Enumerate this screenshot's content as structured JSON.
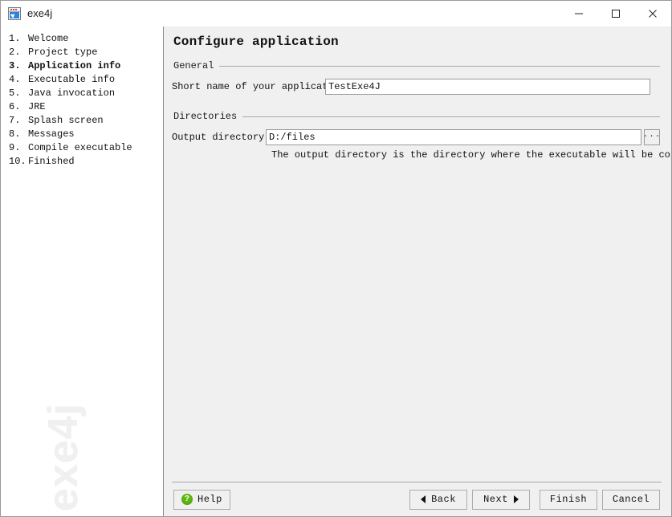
{
  "window": {
    "title": "exe4j",
    "icon": "exe4j-app-icon",
    "controls": {
      "minimize": "minimize-icon",
      "maximize": "maximize-icon",
      "close": "close-icon"
    }
  },
  "sidebar": {
    "watermark": "exe4j",
    "items": [
      {
        "num": "1.",
        "label": "Welcome",
        "active": false
      },
      {
        "num": "2.",
        "label": "Project type",
        "active": false
      },
      {
        "num": "3.",
        "label": "Application info",
        "active": true
      },
      {
        "num": "4.",
        "label": "Executable info",
        "active": false
      },
      {
        "num": "5.",
        "label": "Java invocation",
        "active": false
      },
      {
        "num": "6.",
        "label": "JRE",
        "active": false
      },
      {
        "num": "7.",
        "label": "Splash screen",
        "active": false
      },
      {
        "num": "8.",
        "label": "Messages",
        "active": false
      },
      {
        "num": "9.",
        "label": "Compile executable",
        "active": false
      },
      {
        "num": "10.",
        "label": "Finished",
        "active": false
      }
    ]
  },
  "main": {
    "page_title": "Configure application",
    "groups": {
      "general": {
        "label": "General",
        "short_name": {
          "label": "Short name of your application:",
          "value": "TestExe4J",
          "placeholder": ""
        }
      },
      "directories": {
        "label": "Directories",
        "output_directory": {
          "label": "Output directory:",
          "value": "D:/files",
          "placeholder": "",
          "browse_label": "...",
          "hint": "The output directory is the directory where the executable will be copied."
        }
      }
    }
  },
  "footer": {
    "help_label": "Help",
    "back_label": "Back",
    "next_label": "Next",
    "finish_label": "Finish",
    "cancel_label": "Cancel"
  },
  "colors": {
    "panel_bg": "#f0f0f0",
    "window_bg": "#ffffff",
    "border": "#9a9a9a",
    "help_green": "#5cb811",
    "accent_purple": "#5a3b8c",
    "icon_blue": "#2f82d8",
    "watermark": "#f0f0f0"
  }
}
